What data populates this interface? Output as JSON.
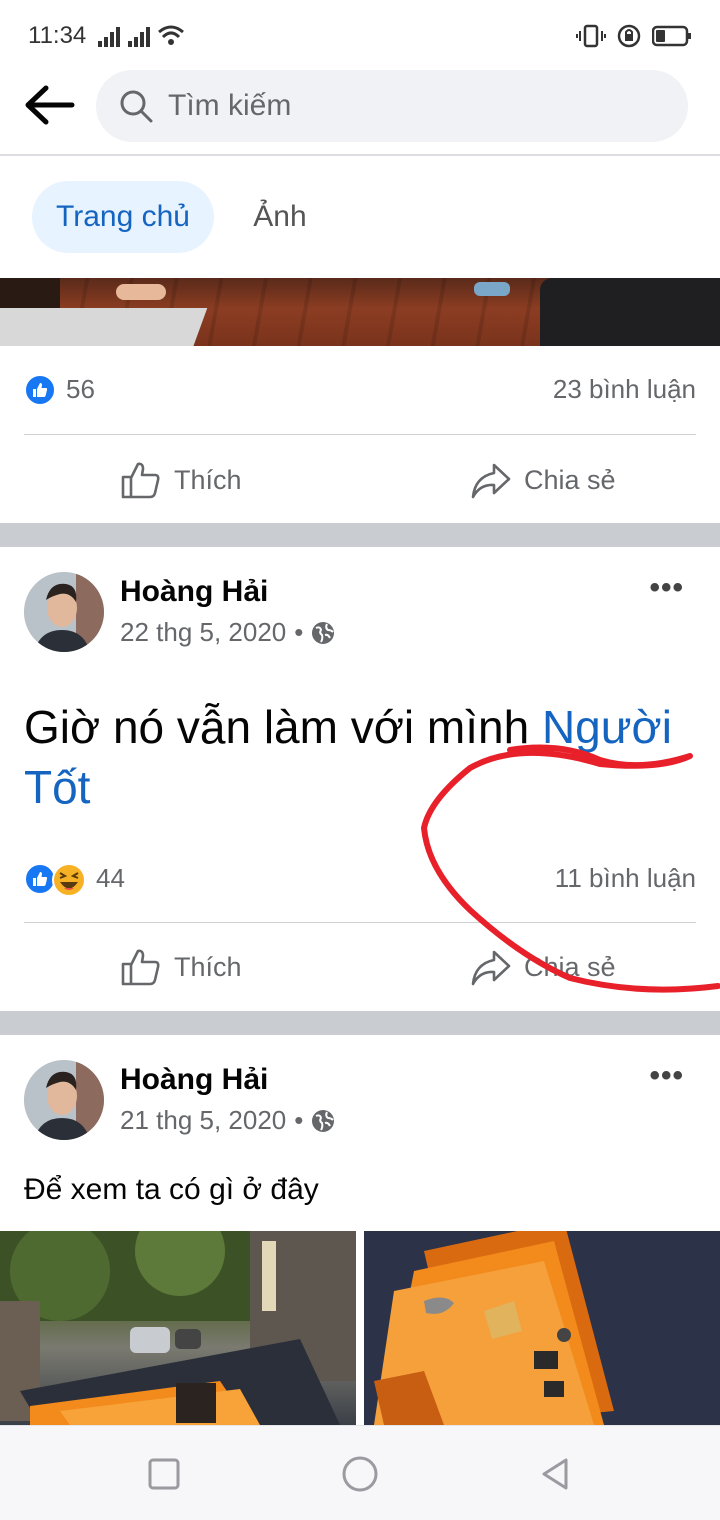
{
  "status_bar": {
    "time": "11:34"
  },
  "search": {
    "placeholder": "Tìm kiếm"
  },
  "tabs": [
    {
      "label": "Trang chủ",
      "active": true
    },
    {
      "label": "Ảnh",
      "active": false
    }
  ],
  "posts": [
    {
      "reaction_count": "56",
      "comments_label": "23 bình luận",
      "like_label": "Thích",
      "share_label": "Chia sẻ"
    },
    {
      "author": "Hoàng Hải",
      "date": "22 thg 5, 2020",
      "dot": "•",
      "text": "Giờ nó vẫn làm với mình ",
      "text_link": "Người Tốt",
      "reaction_count": "44",
      "comments_label": "11 bình luận",
      "like_label": "Thích",
      "share_label": "Chia sẻ"
    },
    {
      "author": "Hoàng Hải",
      "date": "21 thg 5, 2020",
      "dot": "•",
      "text": "Để xem ta có gì ở đây"
    }
  ],
  "colors": {
    "accent": "#1877f2",
    "link": "#1565c0",
    "active_tab_bg": "#e7f3ff",
    "separator": "#c9ccd1",
    "annotation_red": "#e8202a"
  },
  "icons": [
    "back-arrow-icon",
    "search-icon",
    "like-icon",
    "share-icon",
    "globe-icon",
    "more-icon",
    "haha-icon"
  ]
}
